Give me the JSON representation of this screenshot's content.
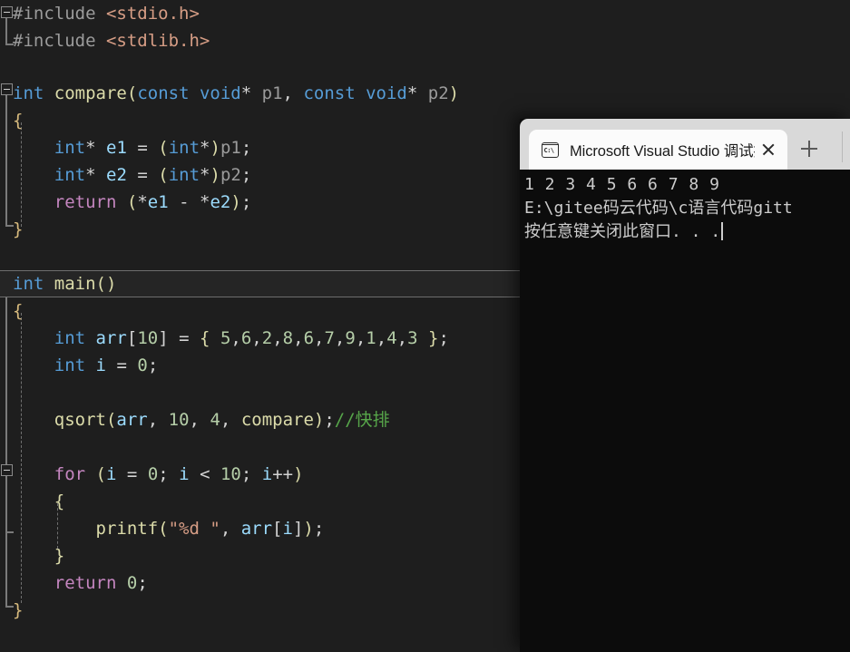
{
  "editor": {
    "name": "visual-studio-code-editor",
    "theme": "dark",
    "background": "#1e1e1e",
    "lines": [
      {
        "id": "l1",
        "text": "#include <stdio.h>"
      },
      {
        "id": "l2",
        "text": "#include <stdlib.h>"
      },
      {
        "id": "l3",
        "text": ""
      },
      {
        "id": "l4",
        "text": "int compare(const void* p1, const void* p2)"
      },
      {
        "id": "l5",
        "text": "{"
      },
      {
        "id": "l6",
        "text": "    int* e1 = (int*)p1;"
      },
      {
        "id": "l7",
        "text": "    int* e2 = (int*)p2;"
      },
      {
        "id": "l8",
        "text": "    return (*e1 - *e2);"
      },
      {
        "id": "l9",
        "text": "}"
      },
      {
        "id": "l10",
        "text": ""
      },
      {
        "id": "l11",
        "text": "int main()"
      },
      {
        "id": "l12",
        "text": "{"
      },
      {
        "id": "l13",
        "text": "    int arr[10] = { 5,6,2,8,6,7,9,1,4,3 };"
      },
      {
        "id": "l14",
        "text": "    int i = 0;"
      },
      {
        "id": "l15",
        "text": ""
      },
      {
        "id": "l16",
        "text": "    qsort(arr, 10, 4, compare);//快排"
      },
      {
        "id": "l17",
        "text": ""
      },
      {
        "id": "l18",
        "text": "    for (i = 0; i < 10; i++)"
      },
      {
        "id": "l19",
        "text": "    {"
      },
      {
        "id": "l20",
        "text": "        printf(\"%d \", arr[i]);"
      },
      {
        "id": "l21",
        "text": "    }"
      },
      {
        "id": "l22",
        "text": "    return 0;"
      },
      {
        "id": "l23",
        "text": "}"
      }
    ],
    "current_line": "int main()",
    "tokens": {
      "include_keyword": "#include",
      "stdio_header": "<stdio.h>",
      "stdlib_header": "<stdlib.h>",
      "comment_quicksort": "//快排",
      "format_string": "\"%d \""
    },
    "colors": {
      "keyword": "#569cd6",
      "control": "#c586c0",
      "function": "#dcdcaa",
      "variable": "#9cdcfe",
      "number": "#b5cea8",
      "string": "#d69d85",
      "comment": "#57a64a",
      "preprocessor": "#9b9b9b",
      "text": "#d4d4d4",
      "background": "#1e1e1e",
      "current_line_bg": "#252525"
    }
  },
  "console": {
    "name": "windows-terminal",
    "titlebar": {
      "tab_title": "Microsoft Visual Studio 调试控",
      "tab_icon": "terminal-icon",
      "close_label": "×",
      "new_tab_label": "+"
    },
    "background": "#0c0c0c",
    "text_color": "#cccccc",
    "output_lines": [
      {
        "id": "out1",
        "text": "1 2 3 4 5 6 6 7 8 9",
        "cjk": false
      },
      {
        "id": "out2",
        "text": "E:\\gitee码云代码\\c语言代码gitt",
        "cjk": true
      },
      {
        "id": "out3",
        "text": "按任意键关闭此窗口. . .",
        "cjk": true
      }
    ],
    "program_output_values": [
      1,
      2,
      3,
      4,
      5,
      6,
      6,
      7,
      8,
      9
    ],
    "exit_prompt": "按任意键关闭此窗口. . ."
  }
}
